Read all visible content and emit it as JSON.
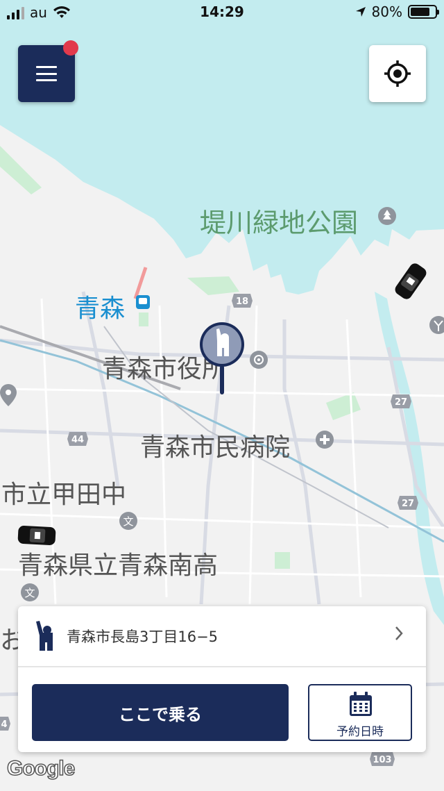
{
  "status_bar": {
    "carrier": "au",
    "time": "14:29",
    "battery": "80%",
    "battery_level": 0.8
  },
  "map": {
    "labels": {
      "park": "堤川緑地公園",
      "station": "青森",
      "city_hall": "青森市役所",
      "hospital": "青森市民病院",
      "school1": "市立甲田中",
      "school2": "青森県立青森南高",
      "partial": "お"
    },
    "road_shields": [
      "18",
      "27",
      "27",
      "44",
      "103",
      "4"
    ]
  },
  "colors": {
    "primary": "#1b2c5a",
    "notification": "#e23a4c",
    "water": "#c3ecef",
    "land": "#f2f2f2",
    "park_text": "#5c9b6e",
    "station_text": "#1a8fd0"
  },
  "icons": {
    "menu": "hamburger-icon",
    "locate": "crosshair-icon",
    "pickup": "waving-person-icon",
    "chevron": "chevron-right-icon",
    "calendar": "calendar-icon"
  },
  "pickup": {
    "address": "青森市長島3丁目16−5"
  },
  "actions": {
    "ride_here": "ここで乗る",
    "reserve": "予約日時"
  },
  "attribution": "Google"
}
